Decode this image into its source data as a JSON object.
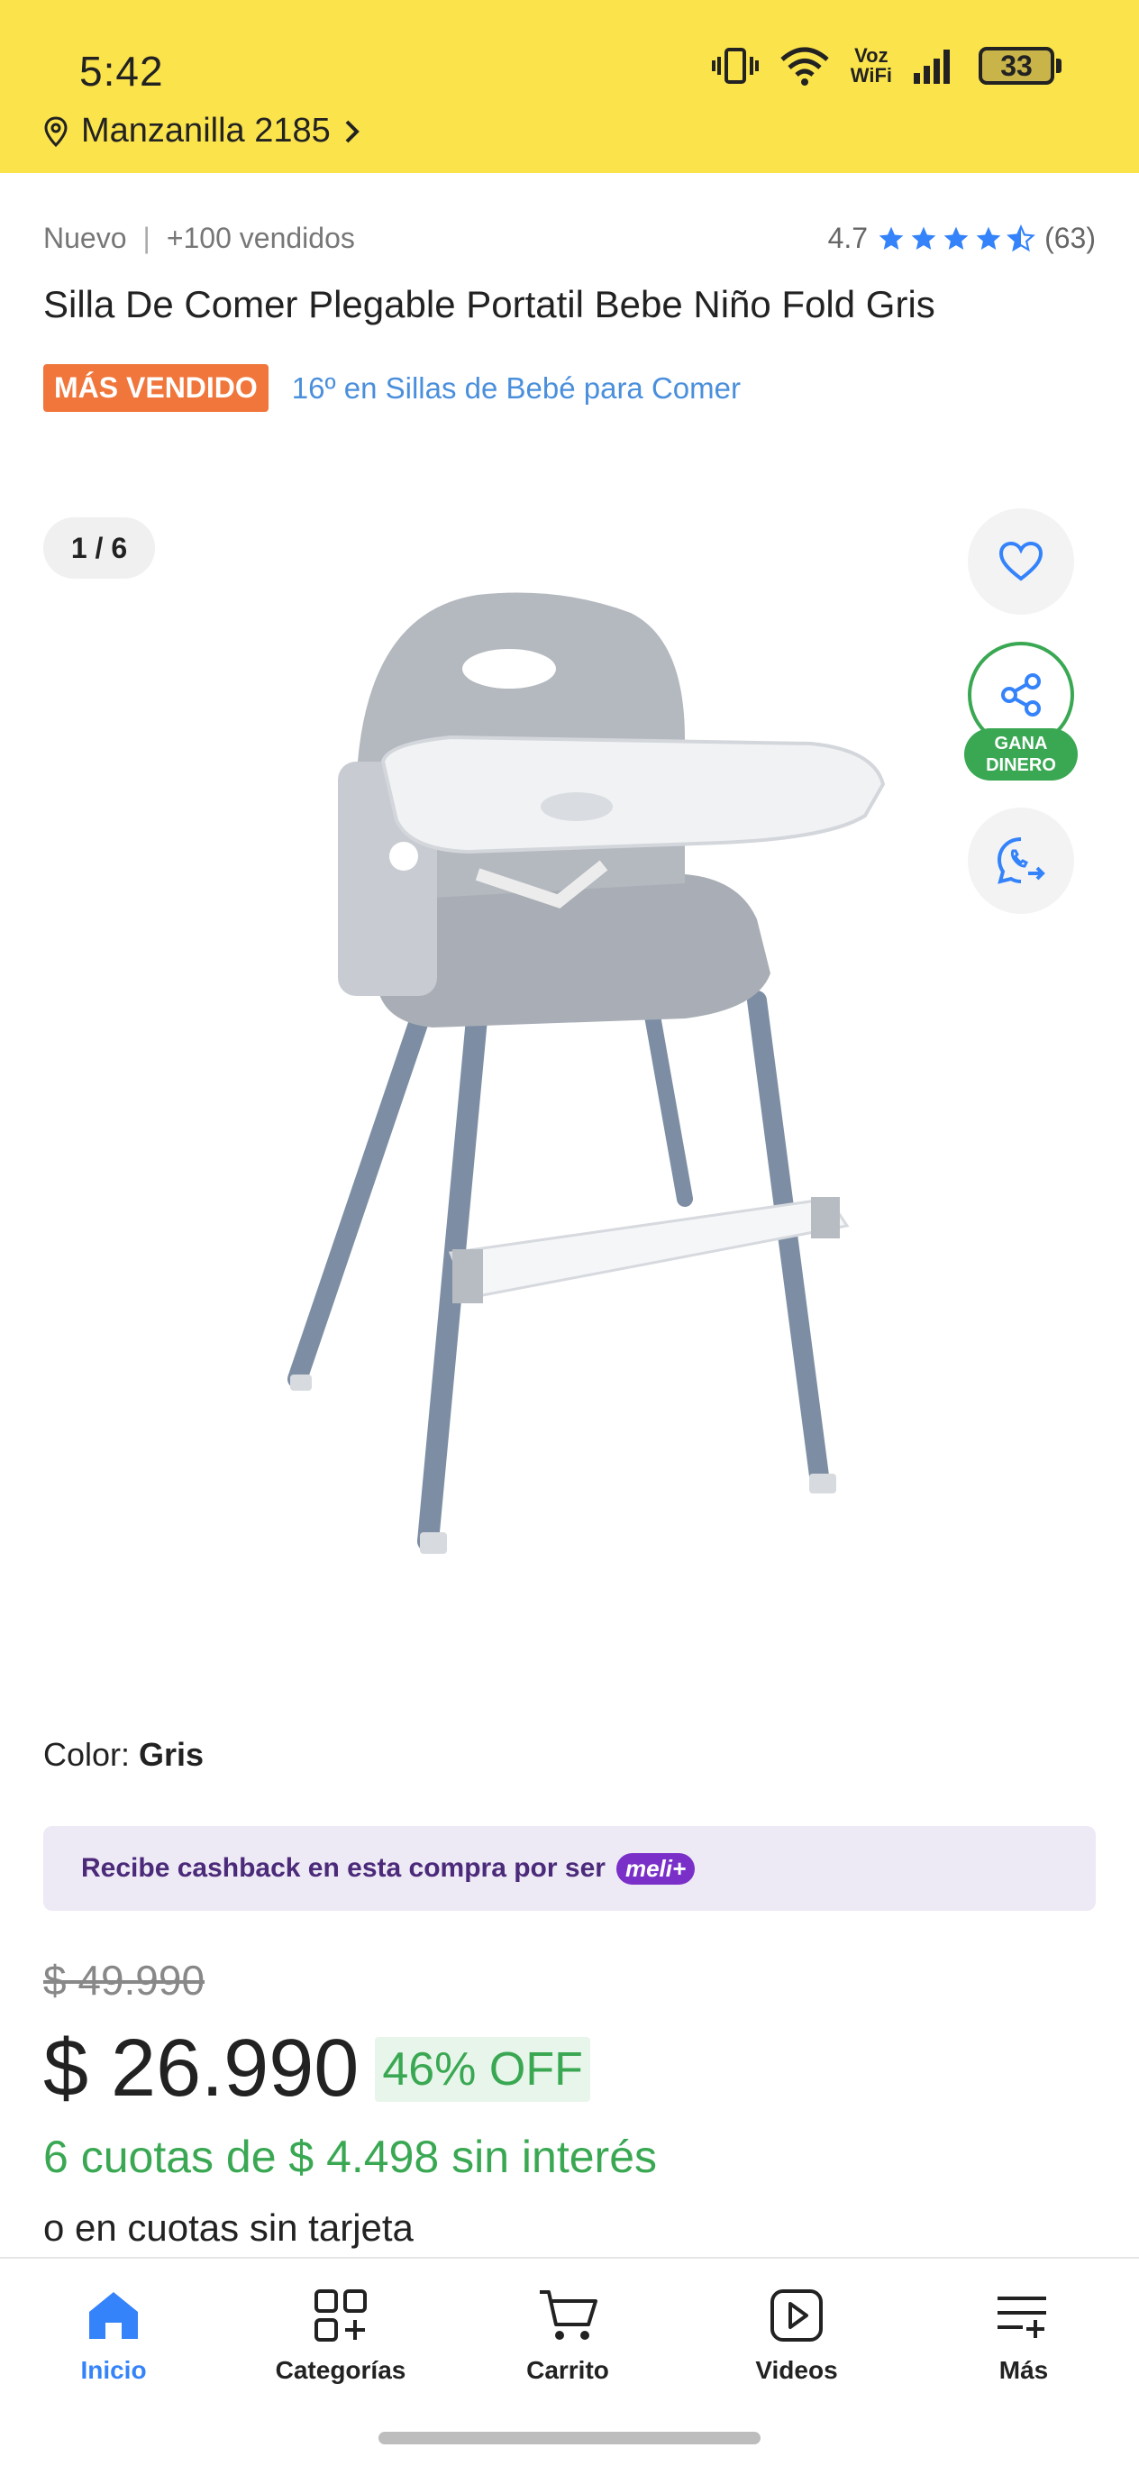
{
  "status_bar": {
    "time": "5:42",
    "voz_line1": "Voz",
    "voz_line2": "WiFi",
    "battery": "33"
  },
  "header": {
    "location": "Manzanilla 2185"
  },
  "product": {
    "condition": "Nuevo",
    "sold": "+100 vendidos",
    "rating": "4.7",
    "reviews": "(63)",
    "title": "Silla De Comer Plegable Portatil Bebe Niño Fold Gris",
    "badge": "MÁS VENDIDO",
    "ranking": "16º en Sillas de Bebé para Comer",
    "image_counter": "1 / 6",
    "gana_line1": "GANA",
    "gana_line2": "DINERO",
    "color_label": "Color: ",
    "color_value": "Gris",
    "cashback_text": "Recibe cashback en esta compra por ser",
    "meli_badge": "meli+",
    "old_price": "$ 49.990",
    "price": "$ 26.990",
    "discount": "46% OFF",
    "installments": "6 cuotas de $ 4.498 sin interés",
    "installments_alt": "o en cuotas sin tarjeta"
  },
  "bottom_nav": {
    "items": [
      {
        "label": "Inicio",
        "icon": "home-icon"
      },
      {
        "label": "Categorías",
        "icon": "categories-icon"
      },
      {
        "label": "Carrito",
        "icon": "cart-icon"
      },
      {
        "label": "Videos",
        "icon": "video-icon"
      },
      {
        "label": "Más",
        "icon": "more-icon"
      }
    ]
  },
  "colors": {
    "header_yellow": "#fbe34c",
    "accent_blue": "#3483fa",
    "green": "#3aa853",
    "badge_orange": "#f0763b"
  }
}
